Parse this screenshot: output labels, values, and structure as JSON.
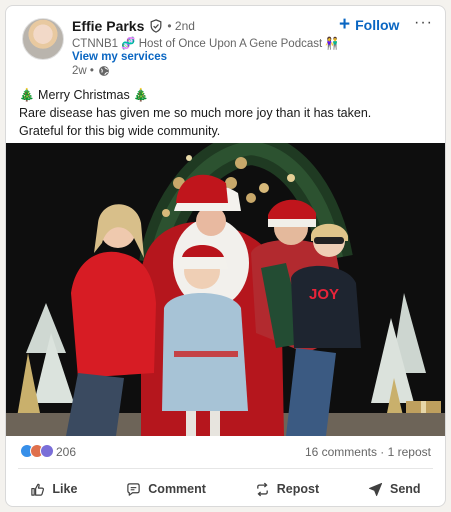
{
  "author": {
    "name": "Effie Parks",
    "degree": "• 2nd",
    "headline": "CTNNB1 🧬 Host of Once Upon A Gene Podcast 👫 E...",
    "services_link": "View my services",
    "posted_ago": "2w •"
  },
  "header_actions": {
    "follow_label": "Follow",
    "more_label": "···"
  },
  "post": {
    "line1": "🎄 Merry Christmas 🎄",
    "line2": "Rare disease has given me so much more joy than it has taken.",
    "line3": "Grateful for this big wide community.",
    "photo_sign_text": "JOY"
  },
  "social": {
    "reaction_count": "206",
    "engagement_text": "16 comments · 1 repost",
    "reaction_colors": [
      "#378fe9",
      "#df704d",
      "#7a6ed8"
    ]
  },
  "actions": {
    "like": "Like",
    "comment": "Comment",
    "repost": "Repost",
    "send": "Send"
  },
  "colors": {
    "brand_blue": "#0a66c2",
    "text_secondary": "#666666"
  }
}
